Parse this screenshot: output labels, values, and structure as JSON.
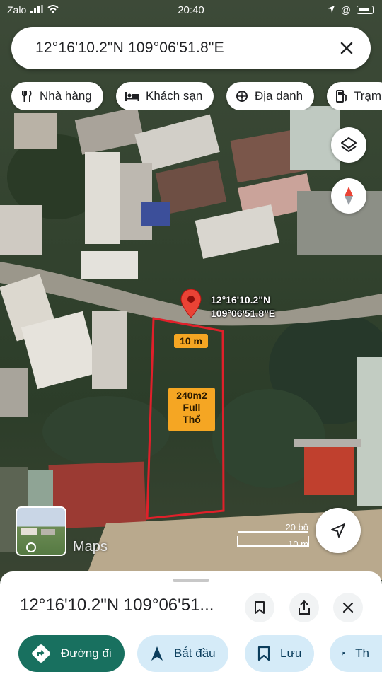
{
  "status_bar": {
    "carrier": "Zalo",
    "time": "20:40",
    "extra": "@"
  },
  "search": {
    "query": "12°16'10.2\"N 109°06'51.8\"E"
  },
  "chips": [
    {
      "label": "Nhà hàng",
      "icon": "restaurant-icon"
    },
    {
      "label": "Khách sạn",
      "icon": "hotel-icon"
    },
    {
      "label": "Địa danh",
      "icon": "landmark-icon"
    },
    {
      "label": "Trạm",
      "icon": "gas-station-icon"
    }
  ],
  "pin": {
    "lat": "12°16'10.2\"N",
    "lng": "109°06'51.8\"E"
  },
  "annotations": {
    "width": "10 m",
    "area_line1": "240m2",
    "area_line2": "Full",
    "area_line3": "Thổ"
  },
  "watermark": "Maps",
  "scale": {
    "imperial": "20 bộ",
    "metric": "10 m"
  },
  "sheet": {
    "title": "12°16'10.2\"N 109°06'51...",
    "actions": [
      {
        "label": "Đường đi",
        "icon": "directions-icon"
      },
      {
        "label": "Bắt đầu",
        "icon": "navigation-arrow-icon"
      },
      {
        "label": "Lưu",
        "icon": "bookmark-icon"
      },
      {
        "label": "Th",
        "icon": "flag-icon"
      }
    ]
  },
  "colors": {
    "primary": "#18705f",
    "secondary_bg": "#d5ebf8",
    "pin": "#ea4335",
    "boundary": "#e0202a",
    "tag": "#f5a623"
  }
}
